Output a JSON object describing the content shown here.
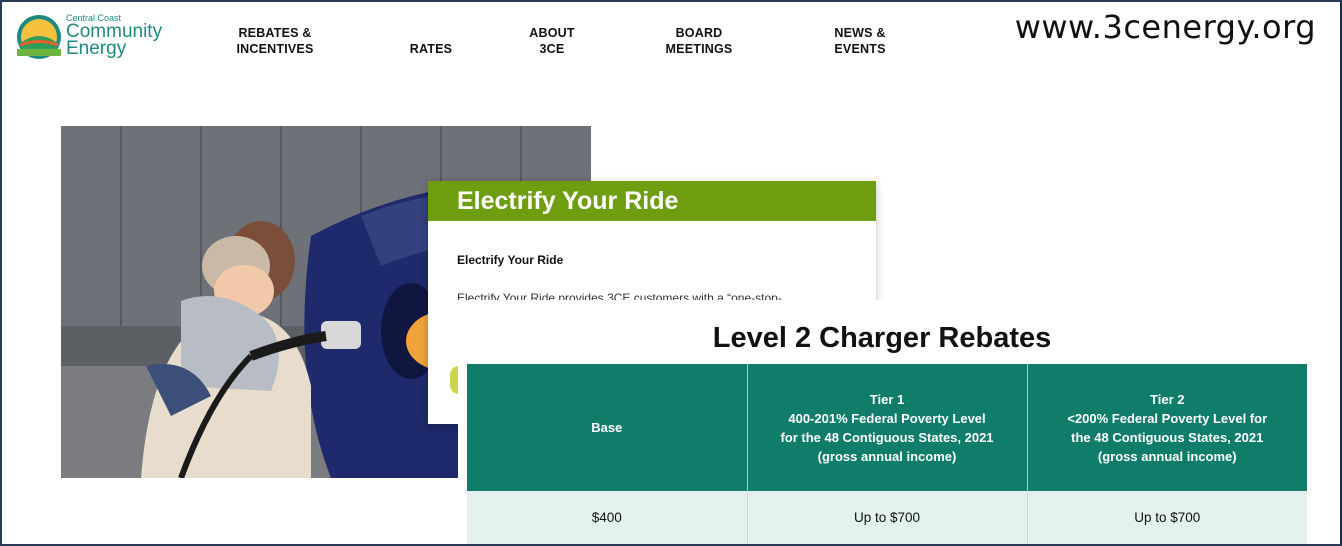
{
  "header": {
    "logo": {
      "small_text": "Central Coast",
      "line1": "Community",
      "line2": "Energy"
    },
    "nav": [
      {
        "line1": "REBATES &",
        "line2": "INCENTIVES"
      },
      {
        "line1": "",
        "line2": "RATES"
      },
      {
        "line1": "ABOUT",
        "line2": "3CE"
      },
      {
        "line1": "BOARD",
        "line2": "MEETINGS"
      },
      {
        "line1": "NEWS &",
        "line2": "EVENTS"
      }
    ],
    "url": "www.3cenergy.org"
  },
  "card": {
    "heading": "Electrify Your Ride",
    "subheading": "Electrify Your Ride",
    "body": "Electrify Your Ride provides 3CE customers with a “one-stop-"
  },
  "rebates": {
    "title": "Level 2 Charger Rebates",
    "columns": [
      {
        "line1": "Base",
        "line2": "",
        "line3": "",
        "line4": ""
      },
      {
        "line1": "Tier 1",
        "line2": "400-201% Federal Poverty Level",
        "line3": "for the 48 Contiguous States, 2021",
        "line4": "(gross annual income)"
      },
      {
        "line1": "Tier 2",
        "line2": "<200% Federal Poverty Level for",
        "line3": "the 48 Contiguous States, 2021",
        "line4": "(gross annual income)"
      }
    ],
    "row": [
      "$400",
      "Up to $700",
      "Up to $700"
    ]
  },
  "colors": {
    "brand_teal": "#1d8a7f",
    "card_green": "#6e9d10",
    "table_header": "#107d6a",
    "table_row": "#e3f2ef"
  }
}
